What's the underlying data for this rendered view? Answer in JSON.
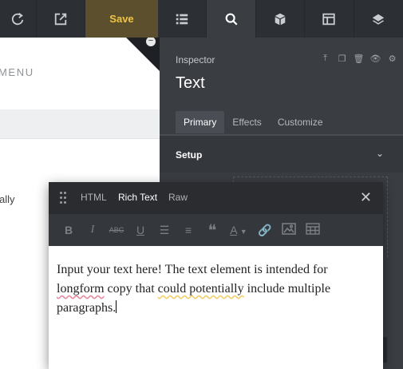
{
  "toolbar": {
    "save_label": "Save",
    "icons": [
      "refresh-icon",
      "external-link-icon",
      "list-icon",
      "search-icon",
      "cube-icon",
      "layout-icon",
      "layers-icon"
    ]
  },
  "canvas": {
    "menu_label": "MENU",
    "partial_text": "ally"
  },
  "inspector": {
    "label": "Inspector",
    "title": "Text",
    "tabs": [
      "Primary",
      "Effects",
      "Customize"
    ],
    "active_tab": "Primary",
    "setup_label": "Setup"
  },
  "editor": {
    "tabs": [
      "HTML",
      "Rich Text",
      "Raw"
    ],
    "active_tab": "Rich Text",
    "body": {
      "part1": "Input your text here! The text element is intended for ",
      "word1": "longform",
      "part2": " copy that ",
      "word2": "could potentially",
      "part3": " include multiple paragraphs."
    }
  },
  "colors": {
    "save_accent": "#f0c542",
    "toolbar_bg": "#2c2f33",
    "panel_bg": "#3a3d42"
  }
}
